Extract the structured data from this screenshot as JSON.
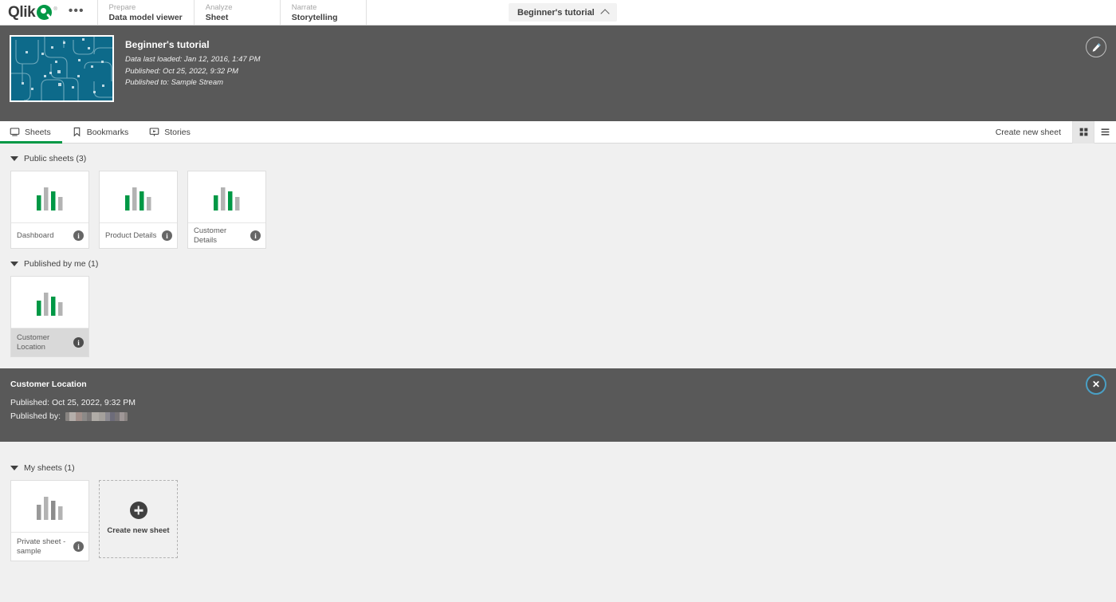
{
  "topbar": {
    "logo_text": "Qlik",
    "logo_icon": "qlik-q-logo",
    "overflow_icon": "ellipsis-icon",
    "nav": [
      {
        "sub": "Prepare",
        "main": "Data model viewer"
      },
      {
        "sub": "Analyze",
        "main": "Sheet"
      },
      {
        "sub": "Narrate",
        "main": "Storytelling"
      }
    ],
    "app_selector": {
      "label": "Beginner's tutorial",
      "icon": "chevron-up-icon"
    }
  },
  "app_header": {
    "title": "Beginner's tutorial",
    "thumbnail_name": "app-thumbnail",
    "thumbnail_color": "#0d6a8a",
    "meta": [
      "Data last loaded: Jan 12, 2016, 1:47 PM",
      "Published: Oct 25, 2022, 9:32 PM",
      "Published to: Sample Stream"
    ],
    "edit_button_icon": "pencil-icon"
  },
  "tabs": [
    {
      "label": "Sheets",
      "icon": "sheet-icon",
      "active": true
    },
    {
      "label": "Bookmarks",
      "icon": "bookmark-icon",
      "active": false
    },
    {
      "label": "Stories",
      "icon": "story-icon",
      "active": false
    }
  ],
  "toolbar": {
    "create_new_sheet_label": "Create new sheet",
    "grid_view_icon": "grid-view-icon",
    "list_view_icon": "list-view-icon",
    "active_view": "grid"
  },
  "sections": [
    {
      "title": "Public sheets",
      "count": "(3)",
      "caret_icon": "caret-down-icon",
      "cards": [
        {
          "label": "Dashboard",
          "thumb": "bar-chart-thumb",
          "selected": false,
          "info_icon": "info-icon"
        },
        {
          "label": "Product Details",
          "thumb": "bar-chart-thumb",
          "selected": false,
          "info_icon": "info-icon"
        },
        {
          "label": "Customer Details",
          "thumb": "bar-chart-thumb",
          "selected": false,
          "info_icon": "info-icon"
        }
      ]
    },
    {
      "title": "Published by me",
      "count": "(1)",
      "caret_icon": "caret-down-icon",
      "cards": [
        {
          "label": "Customer Location",
          "thumb": "bar-chart-thumb",
          "selected": true,
          "info_icon": "info-icon"
        }
      ]
    },
    {
      "title": "My sheets",
      "count": "(1)",
      "caret_icon": "caret-down-icon",
      "cards": [
        {
          "label": "Private sheet - sample",
          "thumb": "bar-chart-thumb-gray",
          "selected": false,
          "info_icon": "info-icon"
        }
      ],
      "create_card": {
        "label": "Create new sheet",
        "icon": "plus-circle-icon"
      }
    }
  ],
  "detail_panel": {
    "title": "Customer Location",
    "published_label": "Published: Oct 25, 2022, 9:32 PM",
    "published_by_label": "Published by:",
    "published_by_value": "",
    "published_by_redacted": true,
    "close_icon": "close-icon"
  },
  "colors": {
    "brand_green": "#009845",
    "dark_panel": "#595959",
    "page_bg": "#f0f0f0",
    "thumbnail_teal": "#0d6a8a",
    "focus_ring": "#4a9fc4"
  }
}
